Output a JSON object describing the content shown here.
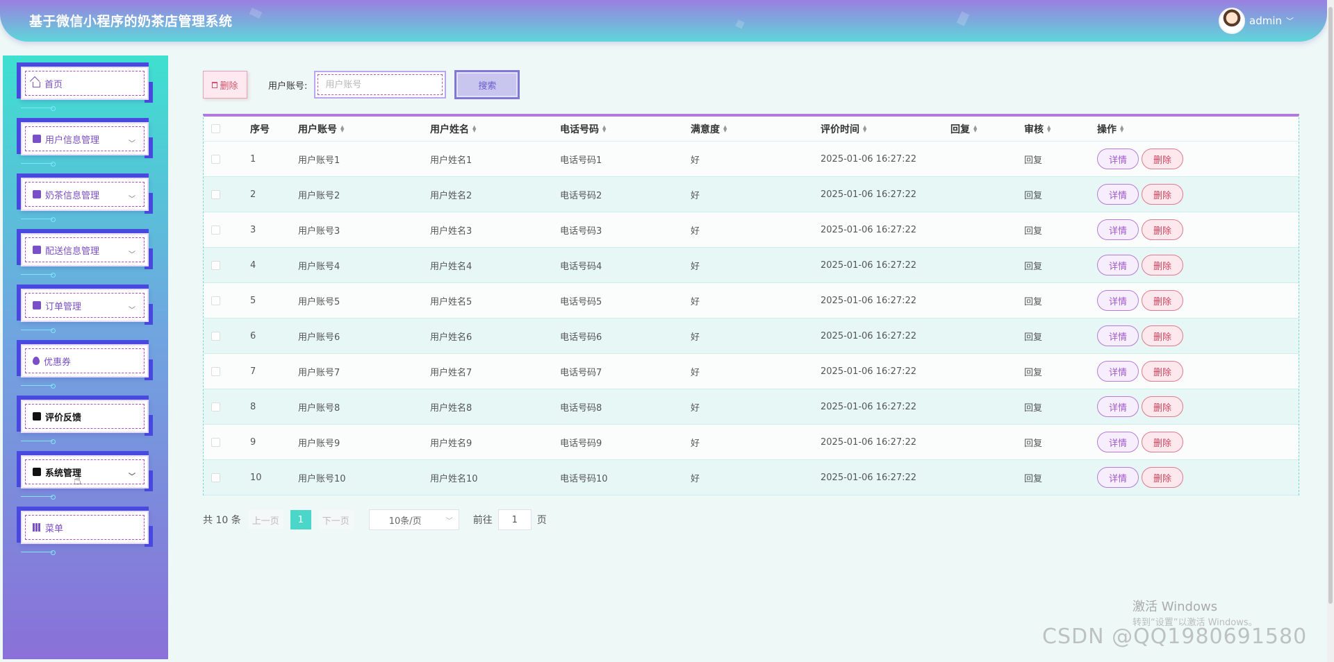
{
  "header": {
    "title": "基于微信小程序的奶茶店管理系统",
    "username": "admin"
  },
  "sidebar": {
    "items": [
      {
        "label": "首页",
        "icon": "home-icon",
        "has_arrow": false
      },
      {
        "label": "用户信息管理",
        "icon": "list-icon",
        "has_arrow": true
      },
      {
        "label": "奶茶信息管理",
        "icon": "list-icon",
        "has_arrow": true
      },
      {
        "label": "配送信息管理",
        "icon": "box-icon",
        "has_arrow": true
      },
      {
        "label": "订单管理",
        "icon": "shop-icon",
        "has_arrow": true
      },
      {
        "label": "优惠券",
        "icon": "drop-icon",
        "has_arrow": false
      },
      {
        "label": "评价反馈",
        "icon": "bag-icon",
        "has_arrow": false,
        "active": true
      },
      {
        "label": "系统管理",
        "icon": "book-icon",
        "has_arrow": true,
        "hover": true
      },
      {
        "label": "菜单",
        "icon": "books-icon",
        "has_arrow": false
      }
    ]
  },
  "toolbar": {
    "delete_label": "删除",
    "account_label": "用户账号:",
    "account_placeholder": "用户账号",
    "search_label": "搜索"
  },
  "table": {
    "columns": [
      "序号",
      "用户账号",
      "用户姓名",
      "电话号码",
      "满意度",
      "评价时间",
      "回复",
      "审核",
      "操作"
    ],
    "rows": [
      {
        "index": "1",
        "account": "用户账号1",
        "name": "用户姓名1",
        "phone": "电话号码1",
        "satisfaction": "好",
        "time": "2025-01-06 16:27:22",
        "reply": "",
        "audit": "回复"
      },
      {
        "index": "2",
        "account": "用户账号2",
        "name": "用户姓名2",
        "phone": "电话号码2",
        "satisfaction": "好",
        "time": "2025-01-06 16:27:22",
        "reply": "",
        "audit": "回复"
      },
      {
        "index": "3",
        "account": "用户账号3",
        "name": "用户姓名3",
        "phone": "电话号码3",
        "satisfaction": "好",
        "time": "2025-01-06 16:27:22",
        "reply": "",
        "audit": "回复"
      },
      {
        "index": "4",
        "account": "用户账号4",
        "name": "用户姓名4",
        "phone": "电话号码4",
        "satisfaction": "好",
        "time": "2025-01-06 16:27:22",
        "reply": "",
        "audit": "回复"
      },
      {
        "index": "5",
        "account": "用户账号5",
        "name": "用户姓名5",
        "phone": "电话号码5",
        "satisfaction": "好",
        "time": "2025-01-06 16:27:22",
        "reply": "",
        "audit": "回复"
      },
      {
        "index": "6",
        "account": "用户账号6",
        "name": "用户姓名6",
        "phone": "电话号码6",
        "satisfaction": "好",
        "time": "2025-01-06 16:27:22",
        "reply": "",
        "audit": "回复"
      },
      {
        "index": "7",
        "account": "用户账号7",
        "name": "用户姓名7",
        "phone": "电话号码7",
        "satisfaction": "好",
        "time": "2025-01-06 16:27:22",
        "reply": "",
        "audit": "回复"
      },
      {
        "index": "8",
        "account": "用户账号8",
        "name": "用户姓名8",
        "phone": "电话号码8",
        "satisfaction": "好",
        "time": "2025-01-06 16:27:22",
        "reply": "",
        "audit": "回复"
      },
      {
        "index": "9",
        "account": "用户账号9",
        "name": "用户姓名9",
        "phone": "电话号码9",
        "satisfaction": "好",
        "time": "2025-01-06 16:27:22",
        "reply": "",
        "audit": "回复"
      },
      {
        "index": "10",
        "account": "用户账号10",
        "name": "用户姓名10",
        "phone": "电话号码10",
        "satisfaction": "好",
        "time": "2025-01-06 16:27:22",
        "reply": "",
        "audit": "回复"
      }
    ],
    "detail_label": "详情",
    "delete_label": "删除"
  },
  "pagination": {
    "total": "共 10 条",
    "prev": "上一页",
    "current": "1",
    "next": "下一页",
    "page_size": "10条/页",
    "goto_label": "前往",
    "goto_value": "1",
    "page_suffix": "页"
  },
  "watermarks": {
    "windows_title": "激活 Windows",
    "windows_sub": "转到“设置”以激活 Windows。",
    "csdn": "CSDN @QQ1980691580"
  },
  "colors": {
    "accent_purple": "#9a7fe0",
    "accent_teal": "#4ad6c8",
    "danger": "#d0445f"
  }
}
